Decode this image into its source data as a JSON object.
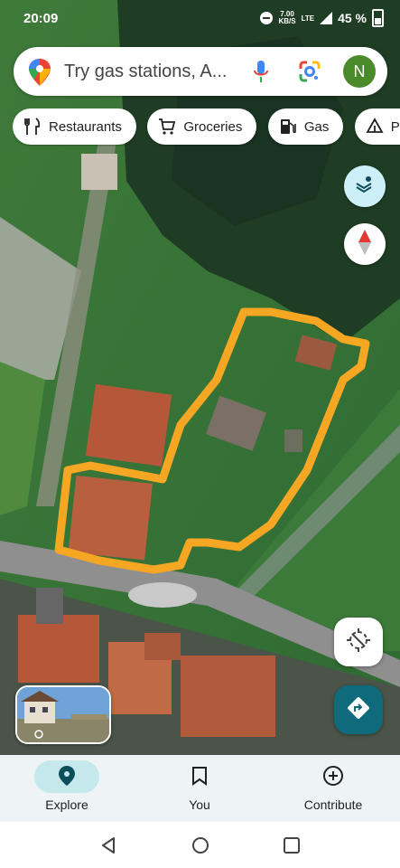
{
  "status_bar": {
    "time": "20:09",
    "speed_value": "7.00",
    "speed_unit": "KB/S",
    "network": "LTE",
    "battery": "45 %"
  },
  "search": {
    "placeholder": "Try gas stations, A...",
    "avatar_letter": "N",
    "icons": [
      "maps-pin-icon",
      "microphone-icon",
      "google-lens-icon"
    ]
  },
  "chips": [
    {
      "label": "Restaurants",
      "icon": "fork-knife-icon"
    },
    {
      "label": "Groceries",
      "icon": "cart-icon"
    },
    {
      "label": "Gas",
      "icon": "gas-pump-icon"
    },
    {
      "label": "Pa",
      "icon": "tent-icon"
    }
  ],
  "map_controls": {
    "layers": "layers-icon",
    "compass": "compass-icon",
    "locate": "location-off-icon",
    "directions": "directions-icon"
  },
  "annotation": {
    "outline_color": "#f5a623"
  },
  "bottom_nav": {
    "explore": "Explore",
    "you": "You",
    "contribute": "Contribute",
    "active": "Explore"
  },
  "colors": {
    "accent_teal": "#0f6a7c",
    "explore_pill": "#c4e8ec",
    "layers_button": "#cdeff7",
    "avatar": "#4b8a2a"
  }
}
